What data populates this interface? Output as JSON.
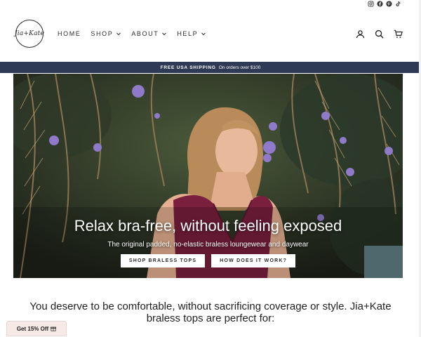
{
  "social": {
    "icons": [
      "instagram-icon",
      "facebook-icon",
      "pinterest-icon",
      "tiktok-icon"
    ]
  },
  "header": {
    "logo_text": "Jia+Kate",
    "nav": [
      {
        "label": "HOME",
        "has_dropdown": false
      },
      {
        "label": "SHOP",
        "has_dropdown": true
      },
      {
        "label": "ABOUT",
        "has_dropdown": true
      },
      {
        "label": "HELP",
        "has_dropdown": true
      }
    ],
    "icons": [
      "account-icon",
      "search-icon",
      "cart-icon"
    ]
  },
  "announcement": {
    "bold": "FREE USA SHIPPING",
    "text": "On orders over $100"
  },
  "hero": {
    "title": "Relax bra-free, without feeling exposed",
    "subtitle": "The original padded, no-elastic braless loungewear and daywear",
    "buttons": [
      "SHOP BRALESS TOPS",
      "HOW DOES IT WORK?"
    ]
  },
  "intro": {
    "text": "You deserve to be comfortable, without sacrificing coverage or style. Jia+Kate braless tops are perfect for:"
  },
  "discount_tab": {
    "label": "Get 15% Off",
    "icon": "gift-icon"
  },
  "colors": {
    "announcement_bg": "#2f3a56",
    "dress": "#7a1f3d",
    "discount_bg": "#f6e9e6"
  }
}
